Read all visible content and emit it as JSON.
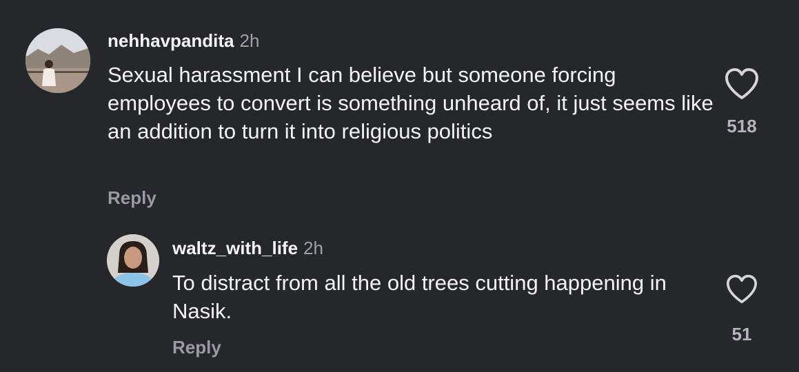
{
  "comments": [
    {
      "username": "nehhavpandita",
      "time": "2h",
      "text": "Sexual harassment I can believe but someone forcing employees to convert is something unheard of, it just seems like an addition to turn it into religious politics",
      "reply_label": "Reply",
      "like_count": "518",
      "like_icon": "heart-outline-icon"
    },
    {
      "username": "waltz_with_life",
      "time": "2h",
      "text": "To distract from all the old trees cutting happening in Nasik.",
      "reply_label": "Reply",
      "like_count": "51",
      "like_icon": "heart-outline-icon"
    }
  ],
  "colors": {
    "background": "#26272b",
    "primary_text": "#f5f5f5",
    "secondary_text": "#a0a0a6"
  }
}
